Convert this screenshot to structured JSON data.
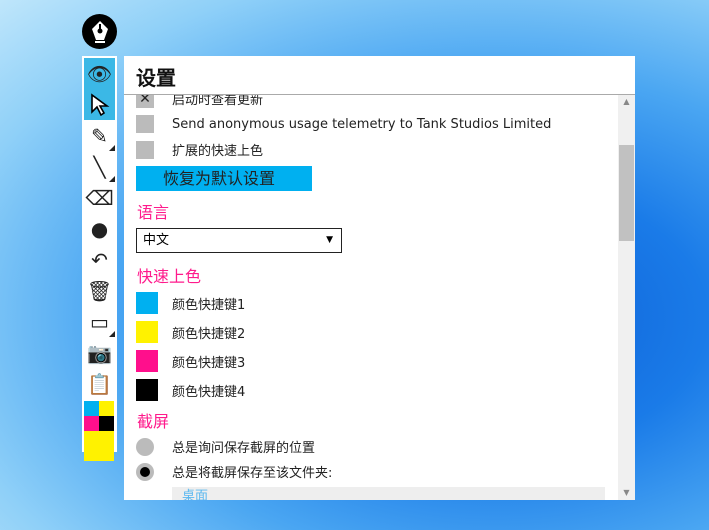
{
  "title": "设置",
  "options": {
    "check_updates": "启动时查看更新",
    "telemetry": "Send anonymous usage telemetry to Tank Studios Limited",
    "extended_colors": "扩展的快速上色"
  },
  "reset_button": "恢复为默认设置",
  "language": {
    "heading": "语言",
    "selected": "中文"
  },
  "quick_colors": {
    "heading": "快速上色",
    "items": [
      {
        "label": "颜色快捷键1",
        "color": "#00b0f0"
      },
      {
        "label": "颜色快捷键2",
        "color": "#fff200"
      },
      {
        "label": "颜色快捷键3",
        "color": "#ff0f8c"
      },
      {
        "label": "颜色快捷键4",
        "color": "#000000"
      }
    ]
  },
  "screenshot": {
    "heading": "截屏",
    "ask": "总是询问保存截屏的位置",
    "save_to": "总是将截屏保存至该文件夹:",
    "folder": "桌面"
  }
}
